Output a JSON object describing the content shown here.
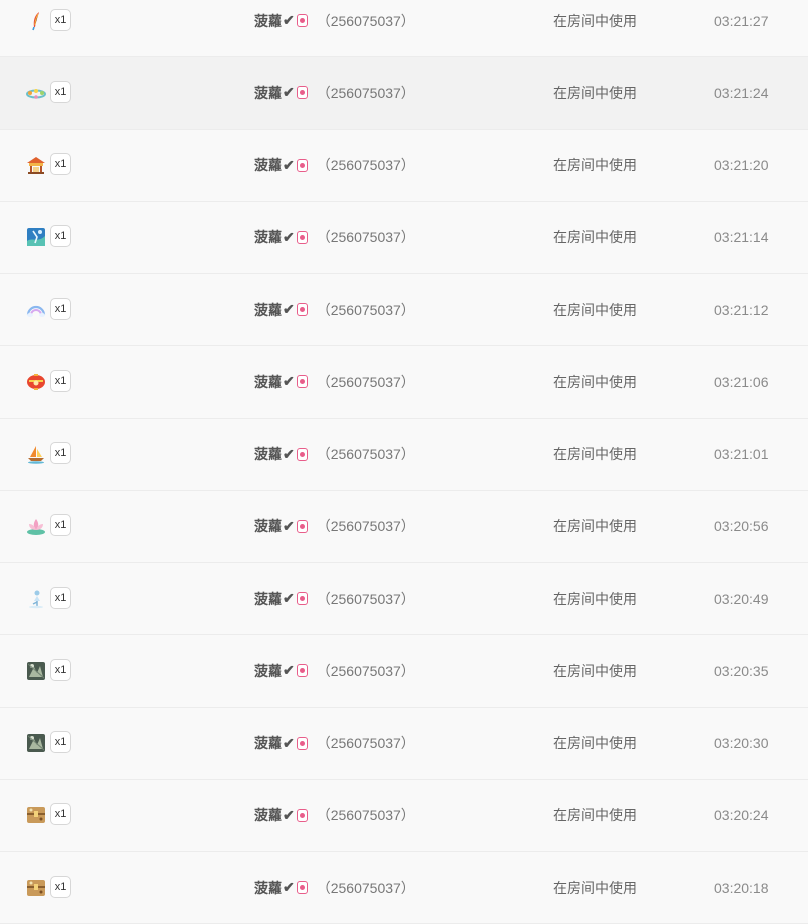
{
  "rows": [
    {
      "gift_icon": "feather-gift-icon",
      "quantity": "x1",
      "username": "菠蘿",
      "verified": "✔",
      "user_id": "（256075037）",
      "action": "在房间中使用",
      "time": "03:21:27"
    },
    {
      "gift_icon": "flower-garland-gift-icon",
      "quantity": "x1",
      "username": "菠蘿",
      "verified": "✔",
      "user_id": "（256075037）",
      "action": "在房间中使用",
      "time": "03:21:24"
    },
    {
      "gift_icon": "pavilion-gift-icon",
      "quantity": "x1",
      "username": "菠蘿",
      "verified": "✔",
      "user_id": "（256075037）",
      "action": "在房间中使用",
      "time": "03:21:20"
    },
    {
      "gift_icon": "card-gift-icon",
      "quantity": "x1",
      "username": "菠蘿",
      "verified": "✔",
      "user_id": "（256075037）",
      "action": "在房间中使用",
      "time": "03:21:14"
    },
    {
      "gift_icon": "rainbow-gift-icon",
      "quantity": "x1",
      "username": "菠蘿",
      "verified": "✔",
      "user_id": "（256075037）",
      "action": "在房间中使用",
      "time": "03:21:12"
    },
    {
      "gift_icon": "lantern-gift-icon",
      "quantity": "x1",
      "username": "菠蘿",
      "verified": "✔",
      "user_id": "（256075037）",
      "action": "在房间中使用",
      "time": "03:21:06"
    },
    {
      "gift_icon": "sailboat-gift-icon",
      "quantity": "x1",
      "username": "菠蘿",
      "verified": "✔",
      "user_id": "（256075037）",
      "action": "在房间中使用",
      "time": "03:21:01"
    },
    {
      "gift_icon": "lotus-gift-icon",
      "quantity": "x1",
      "username": "菠蘿",
      "verified": "✔",
      "user_id": "（256075037）",
      "action": "在房间中使用",
      "time": "03:20:56"
    },
    {
      "gift_icon": "figure-gift-icon",
      "quantity": "x1",
      "username": "菠蘿",
      "verified": "✔",
      "user_id": "（256075037）",
      "action": "在房间中使用",
      "time": "03:20:49"
    },
    {
      "gift_icon": "dark-card-gift-icon",
      "quantity": "x1",
      "username": "菠蘿",
      "verified": "✔",
      "user_id": "（256075037）",
      "action": "在房间中使用",
      "time": "03:20:35"
    },
    {
      "gift_icon": "dark-card-gift-icon",
      "quantity": "x1",
      "username": "菠蘿",
      "verified": "✔",
      "user_id": "（256075037）",
      "action": "在房间中使用",
      "time": "03:20:30"
    },
    {
      "gift_icon": "treasure-chest-gift-icon",
      "quantity": "x1",
      "username": "菠蘿",
      "verified": "✔",
      "user_id": "（256075037）",
      "action": "在房间中使用",
      "time": "03:20:24"
    },
    {
      "gift_icon": "treasure-chest-gift-icon",
      "quantity": "x1",
      "username": "菠蘿",
      "verified": "✔",
      "user_id": "（256075037）",
      "action": "在房间中使用",
      "time": "03:20:18"
    }
  ],
  "colors": {
    "row_bg": "#f9f9f9",
    "row_highlight_bg": "#f2f2f2",
    "divider": "#ececec",
    "badge_pink": "#e85d8a"
  }
}
